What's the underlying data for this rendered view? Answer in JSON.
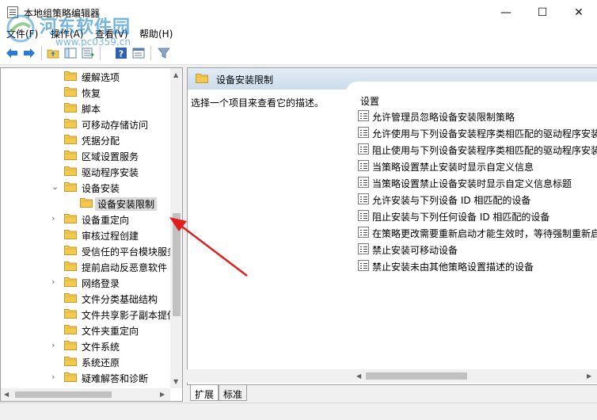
{
  "window": {
    "title": "本地组策略编辑器",
    "minimize_glyph": "—",
    "maximize_glyph": "☐",
    "close_glyph": "✕"
  },
  "watermark": {
    "title": "河东软件园",
    "url": "www.pc0359.cn"
  },
  "menu": {
    "items": [
      "文件(F)",
      "操作(A)",
      "查看(V)",
      "帮助(H)"
    ]
  },
  "toolbar": {
    "icons": [
      "back-arrow-icon",
      "forward-arrow-icon",
      "folder-up-icon",
      "show-hide-tree-icon",
      "export-list-icon",
      "help-icon",
      "properties-icon",
      "filter-icon"
    ]
  },
  "tree": {
    "items": [
      {
        "label": "缓解选项",
        "expander": ""
      },
      {
        "label": "恢复",
        "expander": ""
      },
      {
        "label": "脚本",
        "expander": ""
      },
      {
        "label": "可移动存储访问",
        "expander": ""
      },
      {
        "label": "凭据分配",
        "expander": ""
      },
      {
        "label": "区域设置服务",
        "expander": ""
      },
      {
        "label": "驱动程序安装",
        "expander": ""
      },
      {
        "label": "设备安装",
        "expander": "⌄"
      },
      {
        "label": "设备安装限制",
        "expander": "",
        "selected": true
      },
      {
        "label": "设备重定向",
        "expander": "›"
      },
      {
        "label": "审核过程创建",
        "expander": ""
      },
      {
        "label": "受信任的平台模块服务",
        "expander": ""
      },
      {
        "label": "提前启动反恶意软件",
        "expander": ""
      },
      {
        "label": "网络登录",
        "expander": "›"
      },
      {
        "label": "文件分类基础结构",
        "expander": ""
      },
      {
        "label": "文件共享影子副本提供程序",
        "expander": ""
      },
      {
        "label": "文件夹重定向",
        "expander": ""
      },
      {
        "label": "文件系统",
        "expander": "›"
      },
      {
        "label": "系统还原",
        "expander": ""
      },
      {
        "label": "疑难解答和诊断",
        "expander": "›"
      }
    ]
  },
  "right_pane": {
    "header_title": "设备安装限制",
    "description": "选择一个项目来查看它的描述。",
    "column_header": "设置",
    "policies": [
      "允许管理员忽略设备安装限制策略",
      "允许使用与下列设备安装程序类相匹配的驱动程序安装设备",
      "阻止使用与下列设备安装程序类相匹配的驱动程序安装设备",
      "当策略设置禁止安装时显示自定义信息",
      "当策略设置禁止设备安装时显示自定义信息标题",
      "允许安装与下列设备 ID 相匹配的设备",
      "阻止安装与下列任何设备 ID 相匹配的设备",
      "在策略更改需要重新启动才能生效时，等待强制重新启动",
      "禁止安装可移动设备",
      "禁止安装未由其他策略设置描述的设备"
    ]
  },
  "tabs": {
    "items": [
      "扩展",
      "标准"
    ],
    "active_index": 0
  },
  "colors": {
    "accent_header": "#cddceb",
    "folder_yellow": "#f3c94f",
    "arrow_red": "#e01e1e"
  }
}
